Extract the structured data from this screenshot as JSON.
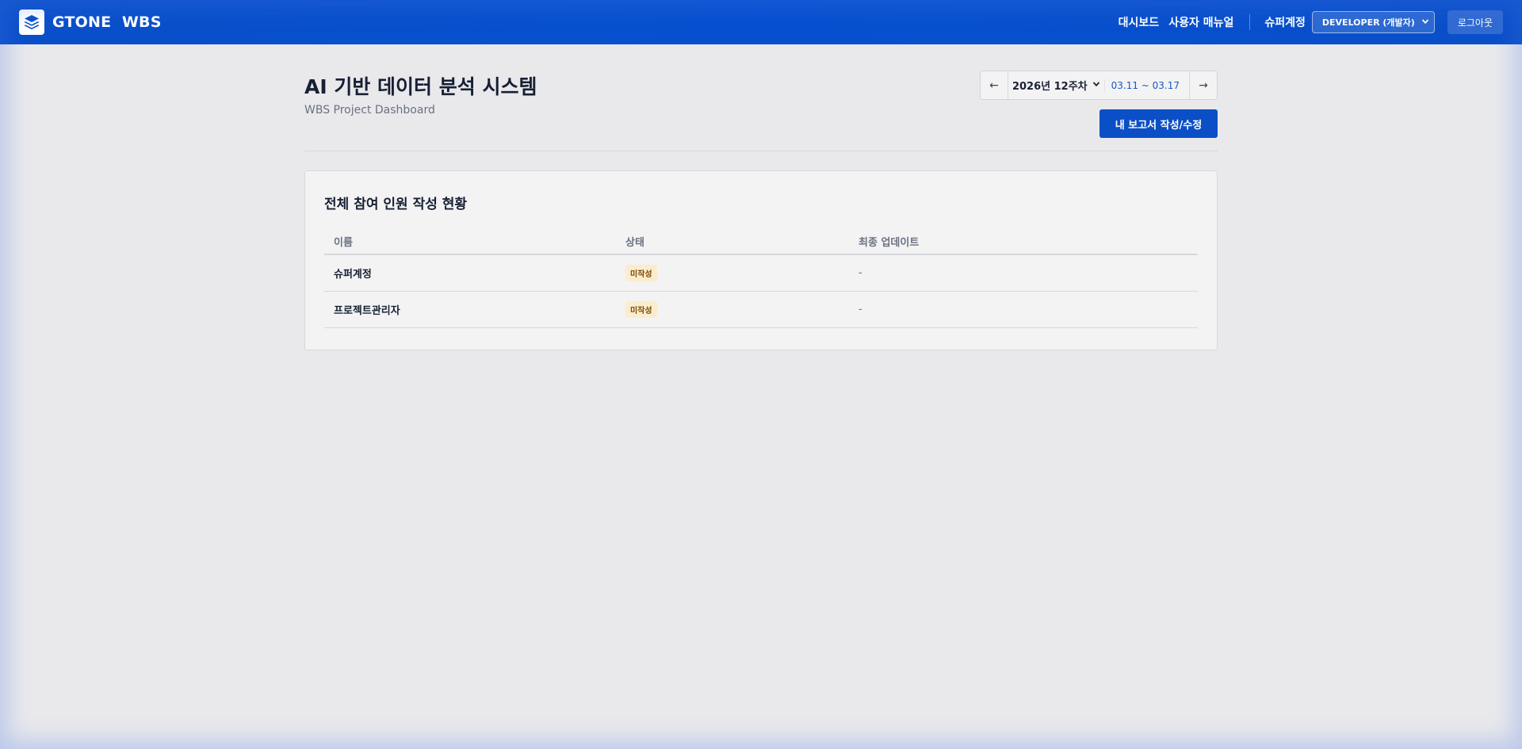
{
  "header": {
    "brand": "GTONE  WBS",
    "nav": [
      "대시보드",
      "사용자 매뉴얼"
    ],
    "user_name": "슈퍼계정",
    "role_selected": "DEVELOPER (개발자)",
    "logout_label": "로그아웃"
  },
  "page": {
    "title": "AI 기반 데이터 분석 시스템",
    "subtitle": "WBS Project Dashboard"
  },
  "week_nav": {
    "prev_label": "←",
    "week_label": "2026년 12주차",
    "range_label": "03.11 ~ 03.17",
    "next_label": "→"
  },
  "report_button_label": "내 보고서 작성/수정",
  "status_card": {
    "title": "전체 참여 인원 작성 현황",
    "columns": [
      "이름",
      "상태",
      "최종 업데이트"
    ],
    "rows": [
      {
        "name": "슈퍼계정",
        "status": "미작성",
        "updated": "-"
      },
      {
        "name": "프로젝트관리자",
        "status": "미작성",
        "updated": "-"
      }
    ]
  },
  "colors": {
    "header_bg": "#0650d0",
    "primary_button": "#0b4fc7",
    "badge_bg": "#fbeccd",
    "badge_text": "#7a4a06",
    "page_bg": "#e9e9ec"
  },
  "icons": {
    "logo": "stacked-layers-icon",
    "dropdown": "chevron-down-icon"
  }
}
